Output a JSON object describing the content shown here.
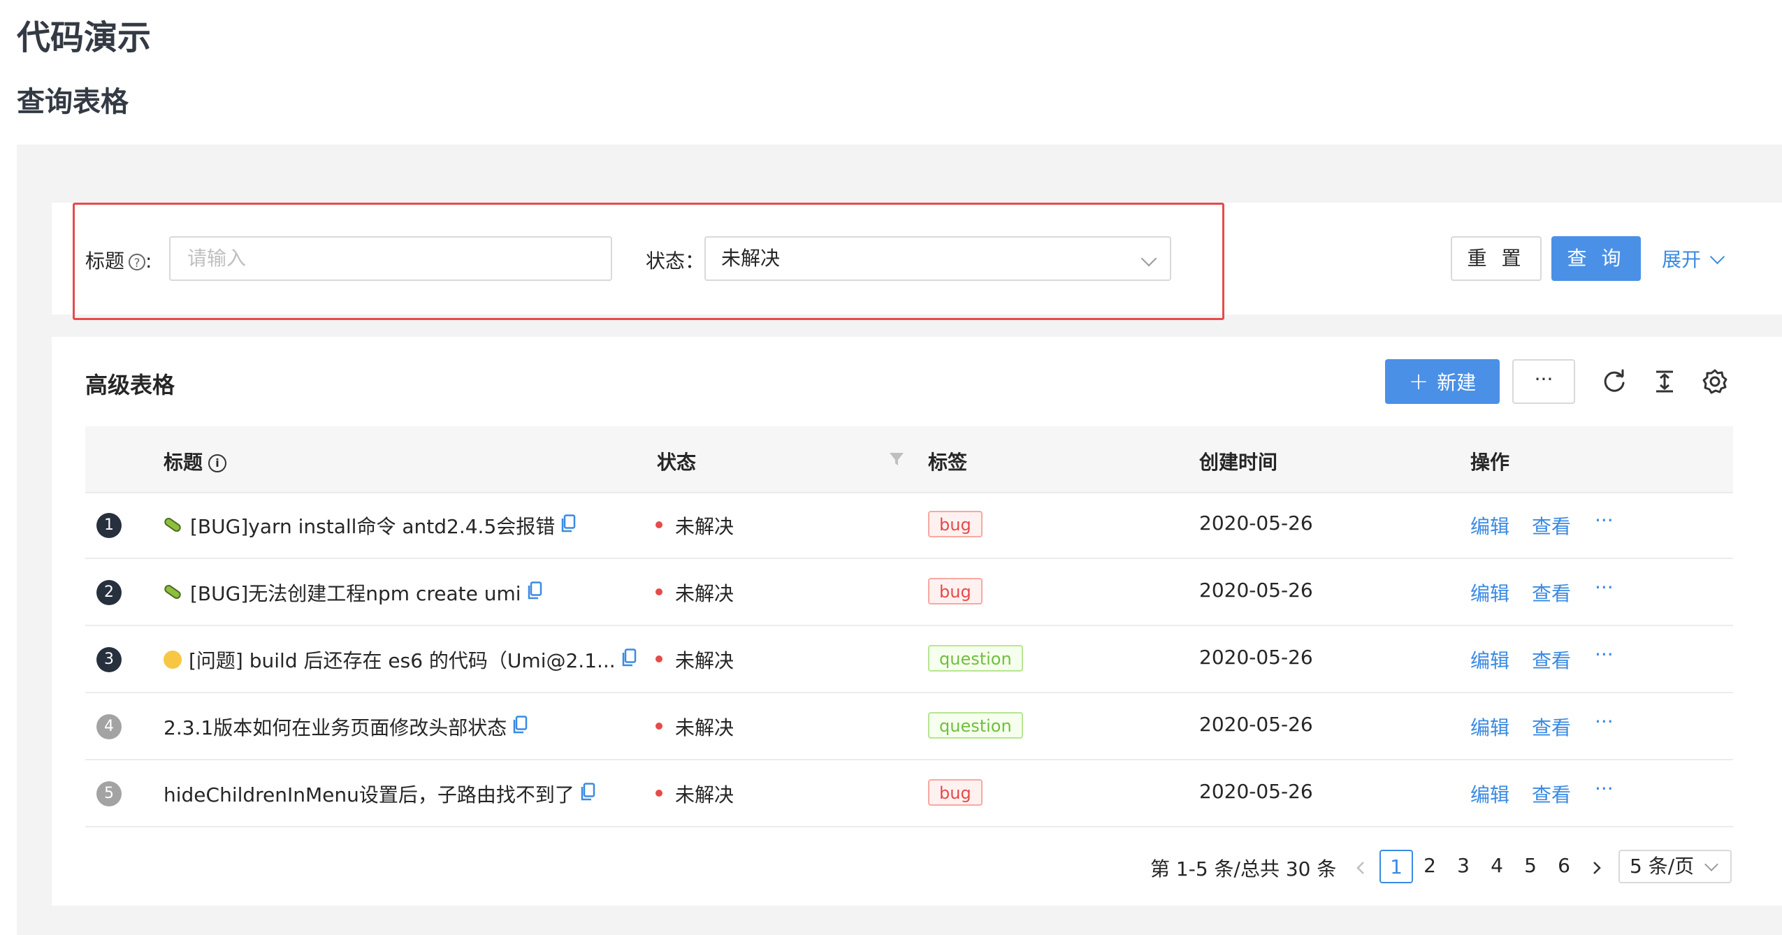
{
  "header": {
    "page_title": "代码演示",
    "section_title": "查询表格"
  },
  "search": {
    "title_label": "标题",
    "colon": ":",
    "title_placeholder": "请输入",
    "status_label": "状态：",
    "status_value": "未解决",
    "reset_label": "重 置",
    "query_label": "查 询",
    "expand_label": "展开"
  },
  "table": {
    "title": "高级表格",
    "new_label": "新建",
    "more_label": "···",
    "columns": {
      "title": "标题",
      "status": "状态",
      "tags": "标签",
      "created": "创建时间",
      "actions": "操作"
    },
    "rows": [
      {
        "index": "1",
        "emoji": "bug",
        "title": "[BUG]yarn install命令 antd2.4.5会报错",
        "status": "未解决",
        "tag": "bug",
        "tag_color": "red",
        "created": "2020-05-26",
        "edit": "编辑",
        "view": "查看",
        "more": "···"
      },
      {
        "index": "2",
        "emoji": "bug",
        "title": "[BUG]无法创建工程npm create umi",
        "status": "未解决",
        "tag": "bug",
        "tag_color": "red",
        "created": "2020-05-26",
        "edit": "编辑",
        "view": "查看",
        "more": "···"
      },
      {
        "index": "3",
        "emoji": "thinking",
        "title": "[问题] build 后还存在 es6 的代码（Umi@2.1...",
        "status": "未解决",
        "tag": "question",
        "tag_color": "green",
        "created": "2020-05-26",
        "edit": "编辑",
        "view": "查看",
        "more": "···"
      },
      {
        "index": "4",
        "emoji": "",
        "title": "2.3.1版本如何在业务页面修改头部状态",
        "status": "未解决",
        "tag": "question",
        "tag_color": "green",
        "created": "2020-05-26",
        "edit": "编辑",
        "view": "查看",
        "more": "···"
      },
      {
        "index": "5",
        "emoji": "",
        "title": "hideChildrenInMenu设置后，子路由找不到了",
        "status": "未解决",
        "tag": "bug",
        "tag_color": "red",
        "created": "2020-05-26",
        "edit": "编辑",
        "view": "查看",
        "more": "···"
      }
    ]
  },
  "pagination": {
    "summary": "第 1-5 条/总共 30 条",
    "pages": [
      "1",
      "2",
      "3",
      "4",
      "5",
      "6"
    ],
    "current": "1",
    "page_size": "5 条/页"
  },
  "colors": {
    "primary": "#4a90e6",
    "link": "#3b8ae2",
    "error": "#e54b4b",
    "success": "#6fbf3f",
    "highlight_border": "#e54b4b"
  },
  "icons": [
    "question-circle-icon",
    "chevron-down-icon",
    "plus-icon",
    "reload-icon",
    "column-height-icon",
    "setting-icon",
    "info-circle-icon",
    "filter-icon",
    "copy-icon",
    "bug-emoji-icon",
    "thinking-emoji-icon",
    "chevron-left-icon",
    "chevron-right-icon"
  ]
}
